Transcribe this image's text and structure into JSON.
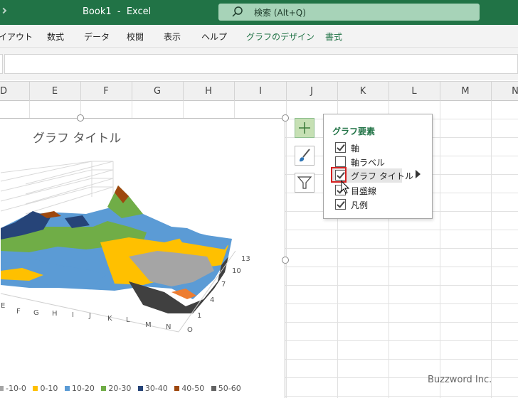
{
  "titlebar": {
    "title": "Book1  -  Excel",
    "search_placeholder": "検索 (Alt+Q)"
  },
  "ribbon": {
    "tabs": [
      "イアウト",
      "数式",
      "データ",
      "校閲",
      "表示",
      "ヘルプ",
      "グラフのデザイン",
      "書式"
    ],
    "active_tab": "グラフのデザイン"
  },
  "columns": [
    "D",
    "E",
    "F",
    "G",
    "H",
    "I",
    "J",
    "K",
    "L",
    "M",
    "N"
  ],
  "chart": {
    "title": "グラフ タイトル",
    "x_tick_labels": [
      "E",
      "F",
      "G",
      "H",
      "I",
      "J",
      "K",
      "L",
      "L",
      "M",
      "N"
    ],
    "y_tick_labels": [
      "O",
      "1",
      "4",
      "7",
      "10",
      "13"
    ],
    "legend": [
      {
        "label": "-10-0",
        "color": "#a5a5a5"
      },
      {
        "label": "0-10",
        "color": "#ffc000"
      },
      {
        "label": "10-20",
        "color": "#5b9bd5"
      },
      {
        "label": "20-30",
        "color": "#70ad47"
      },
      {
        "label": "30-40",
        "color": "#264478"
      },
      {
        "label": "40-50",
        "color": "#9e480e"
      },
      {
        "label": "50-60",
        "color": "#636363"
      }
    ]
  },
  "side_buttons": {
    "add_element": "plus-icon",
    "style": "brush-icon",
    "filter": "filter-icon"
  },
  "chart_elements_popup": {
    "title": "グラフ要素",
    "items": [
      {
        "label": "軸",
        "checked": true
      },
      {
        "label": "軸ラベル",
        "checked": false
      },
      {
        "label": "グラフ タイトル",
        "checked": true
      },
      {
        "label": "目盛線",
        "checked": true
      },
      {
        "label": "凡例",
        "checked": true
      }
    ]
  },
  "watermark": "Buzzword Inc."
}
